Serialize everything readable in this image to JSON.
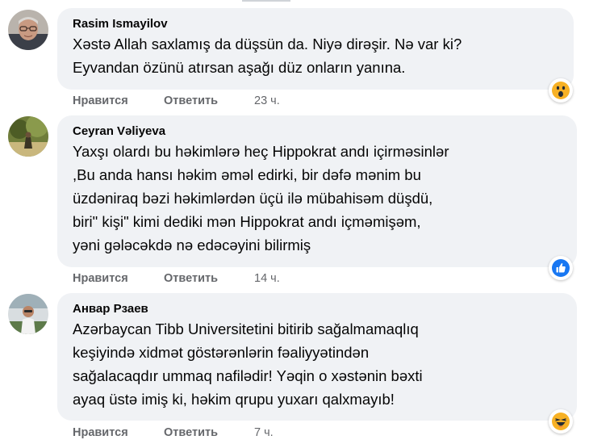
{
  "comments": [
    {
      "author": "Rasim Ismayilov",
      "text": "Xəstə Allah saxlamış da düşsün da. Niyə dirəşir. Nə var ki?\nEyvandan özünü atırsan aşağı düz onların yanına.",
      "actions": {
        "like": "Нравится",
        "reply": "Ответить",
        "time": "23 ч."
      },
      "reaction": "wow-emoji",
      "avatar": "avatar-man-glasses"
    },
    {
      "author": "Ceyran Vəliyeva",
      "text": "Yaxşı olardı bu həkimlərə heç Hippokrat andı içirməsinlər\n,Bu anda hansı həkim əməl edirki, bir dəfə mənim bu\nüzdəniraq bəzi həkimlərdən üçü ilə mübahisəm düşdü,\nbiri\" kişi\" kimi dediki mən Hippokrat andı içməmişəm,\nyəni gələcəkdə nə edəcəyini bilirmiş",
      "actions": {
        "like": "Нравится",
        "reply": "Ответить",
        "time": "14 ч."
      },
      "reaction": "like-emoji",
      "avatar": "avatar-nature"
    },
    {
      "author": "Анвар Рзаев",
      "text": "Azərbaycan Tibb Universitetini bitirib sağalmamaqlıq\nkeşiyində xidmət göstərənlərin fəaliyyətindən\nsağalacaqdır ummaq nafilədir! Yəqin o xəstənin bəxti\nayaq üstə imiş ki, həkim qrupu yuxarı qalxmayıb!",
      "actions": {
        "like": "Нравится",
        "reply": "Ответить",
        "time": "7 ч."
      },
      "reaction": "haha-emoji",
      "avatar": "avatar-man-outdoor"
    }
  ],
  "colors": {
    "bubble": "#f0f2f5",
    "meta": "#65676b",
    "like_blue": "#1877f2",
    "emoji_yellow": "#f7b125"
  }
}
